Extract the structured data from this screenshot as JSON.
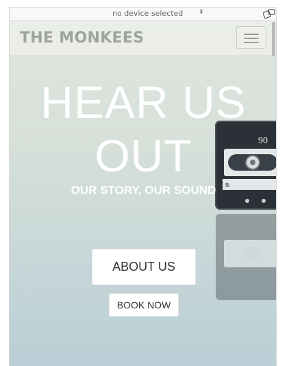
{
  "devicebar": {
    "device_select": "no device selected",
    "arrows": "⬍",
    "rotate_icon": "rotate-device-icon"
  },
  "navbar": {
    "brand": "THE MONKEES",
    "toggle_icon": "hamburger-menu-icon"
  },
  "hero": {
    "title_line1": "HEAR US",
    "title_line2": "OUT",
    "subtitle": "OUR STORY, OUR SOUND",
    "about_button": "ABOUT US",
    "book_button": "BOOK NOW",
    "cassette_label": "90",
    "cassette_side": "B:"
  },
  "colors": {
    "brand": "#9ea39c",
    "hero_text": "#ffffff",
    "button_bg": "#ffffff",
    "button_text": "#333333"
  }
}
